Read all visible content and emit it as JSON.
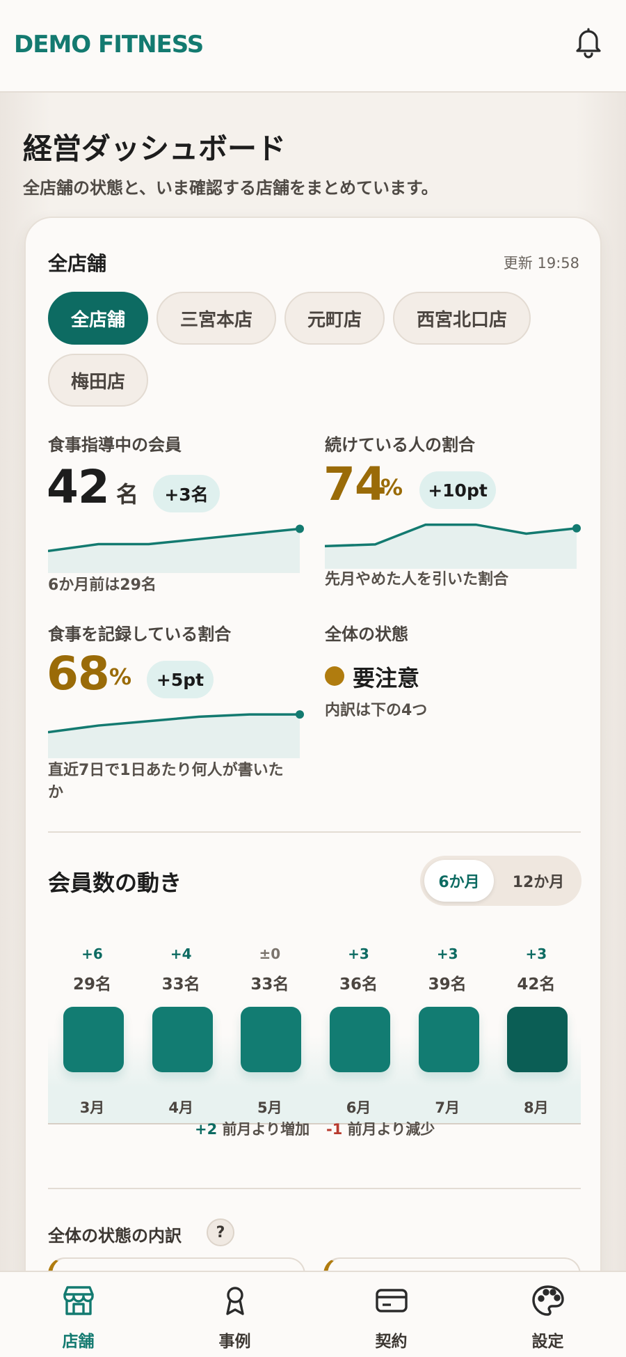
{
  "header": {
    "brand": "DEMO FITNESS"
  },
  "page": {
    "title": "経営ダッシュボード",
    "subtitle": "全店舗の状態と、いま確認する店舗をまとめています。"
  },
  "card": {
    "title": "全店舗",
    "updated": "更新 19:58",
    "stores": [
      "全店舗",
      "三宮本店",
      "元町店",
      "西宮北口店",
      "梅田店"
    ],
    "selected_store": "全店舗"
  },
  "metrics": {
    "diet_members": {
      "label": "食事指導中の会員",
      "value": "42",
      "unit": "名",
      "delta": "+3名",
      "note": "6か月前は29名",
      "trend": [
        29,
        33,
        33,
        36,
        39,
        42
      ]
    },
    "retention": {
      "label": "続けている人の割合",
      "value": "74",
      "unit": "%",
      "delta": "+10pt",
      "note": "先月やめた人を引いた割合",
      "trend": [
        64,
        65,
        76,
        76,
        71,
        74
      ]
    },
    "logging": {
      "label": "食事を記録している割合",
      "value": "68",
      "unit": "%",
      "delta": "+5pt",
      "note": "直近7日で1日あたり何人が書いたか",
      "trend": [
        60,
        63,
        65,
        67,
        68,
        68
      ]
    },
    "overall": {
      "label": "全体の状態",
      "status": "要注意",
      "note": "内訳は下の4つ",
      "status_color": "#b07c0f"
    }
  },
  "members_section": {
    "title": "会員数の動き",
    "ranges": [
      "6か月",
      "12か月"
    ],
    "selected_range": "6か月",
    "legend": {
      "up_value": "+2",
      "up_text": "前月より増加",
      "down_value": "-1",
      "down_text": "前月より減少"
    }
  },
  "chart_data": {
    "type": "bar",
    "categories": [
      "3月",
      "4月",
      "5月",
      "6月",
      "7月",
      "8月"
    ],
    "values": [
      29,
      33,
      33,
      36,
      39,
      42
    ],
    "value_labels": [
      "29名",
      "33名",
      "33名",
      "36名",
      "39名",
      "42名"
    ],
    "deltas": [
      "+6",
      "+4",
      "±0",
      "+3",
      "+3",
      "+3"
    ],
    "title": "会員数の動き"
  },
  "breakdown": {
    "title": "全体の状態の内訳",
    "help": "?"
  },
  "tabs": [
    {
      "label": "店舗",
      "icon": "store-icon",
      "active": true
    },
    {
      "label": "事例",
      "icon": "award-icon",
      "active": false
    },
    {
      "label": "契約",
      "icon": "credit-card-icon",
      "active": false
    },
    {
      "label": "設定",
      "icon": "palette-icon",
      "active": false
    }
  ],
  "colors": {
    "brand": "#137a70",
    "accent_gold": "#9a6b08",
    "bar": "#127c72",
    "bar_current": "#0b5e55",
    "down": "#b83a2e"
  }
}
